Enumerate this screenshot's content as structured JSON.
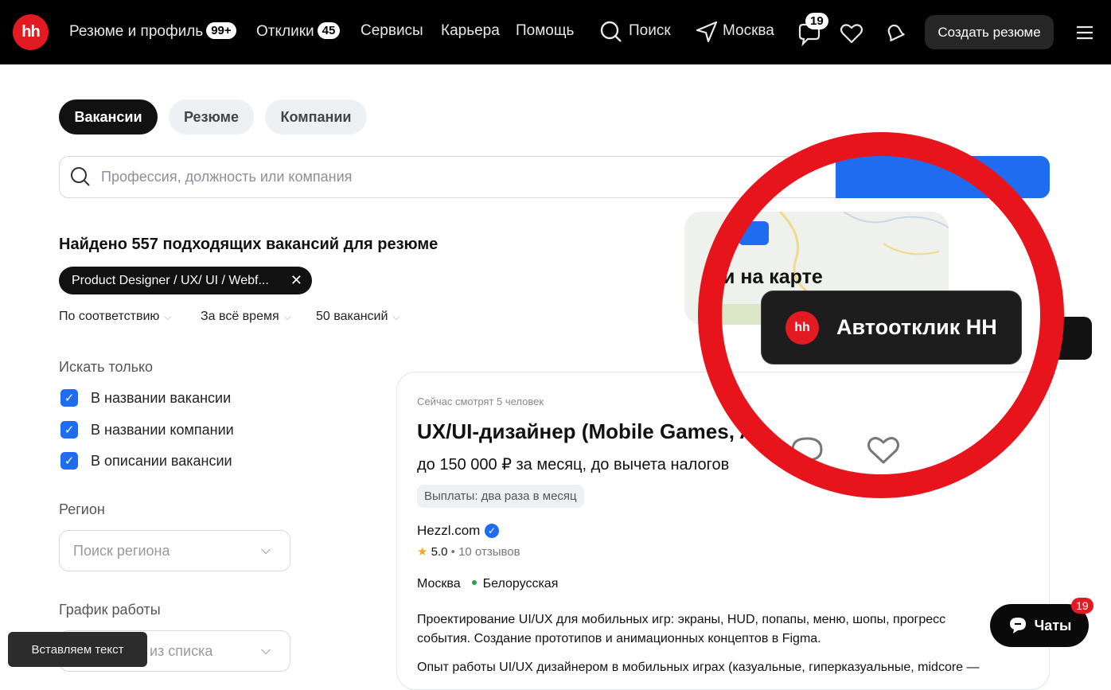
{
  "header": {
    "logo": "hh",
    "nav": [
      {
        "label": "Резюме и профиль",
        "badge": "99+"
      },
      {
        "label": "Отклики",
        "badge": "45"
      },
      {
        "label": "Сервисы"
      },
      {
        "label": "Карьера"
      },
      {
        "label": "Помощь"
      }
    ],
    "search_label": "Поиск",
    "city_label": "Москва",
    "chat_badge": "19",
    "create_label": "Создать резюме"
  },
  "tabs": [
    "Вакансии",
    "Резюме",
    "Компании"
  ],
  "search": {
    "placeholder": "Профессия, должность или компания"
  },
  "results": {
    "found_text": "Найдено 557 подходящих вакансий для резюме",
    "chip": "Product Designer / UX/ UI / Webf...",
    "sort": [
      "По соответствию",
      "За всё время",
      "50 вакансий"
    ]
  },
  "filters": {
    "search_only_label": "Искать только",
    "checkboxes": [
      "В названии вакансии",
      "В названии компании",
      "В описании вакансии"
    ],
    "region_label": "Регион",
    "region_placeholder": "Поиск региона",
    "schedule_label": "График работы",
    "schedule_placeholder": "из списка"
  },
  "overlay": {
    "map_text": "и на карте",
    "autoresponse_label": "Автоотклик HH",
    "logo": "hh"
  },
  "vacancy": {
    "viewing_now": "Сейчас смотрят 5 человек",
    "title": "UX/UI-дизайнер (Mobile Games, A",
    "salary": "до 150 000 ₽ за месяц, до вычета налогов",
    "payment_chip": "Выплаты: два раза в месяц",
    "company": "Hezzl.com",
    "rating": "5.0",
    "reviews": "10 отзывов",
    "city": "Москва",
    "metro": "Белорусская",
    "desc_lines": [
      "Проектирование UI/UX для мобильных игр: экраны, HUD, попапы, меню, шопы, прогресс",
      "события. Создание прототипов и анимационных концептов в Figma.",
      "Опыт работы UI/UX дизайнером в мобильных играх (казуальные, гиперказуальные, midcore —"
    ]
  },
  "toast": "Вставляем текст",
  "chats": {
    "label": "Чаты",
    "badge": "19"
  }
}
